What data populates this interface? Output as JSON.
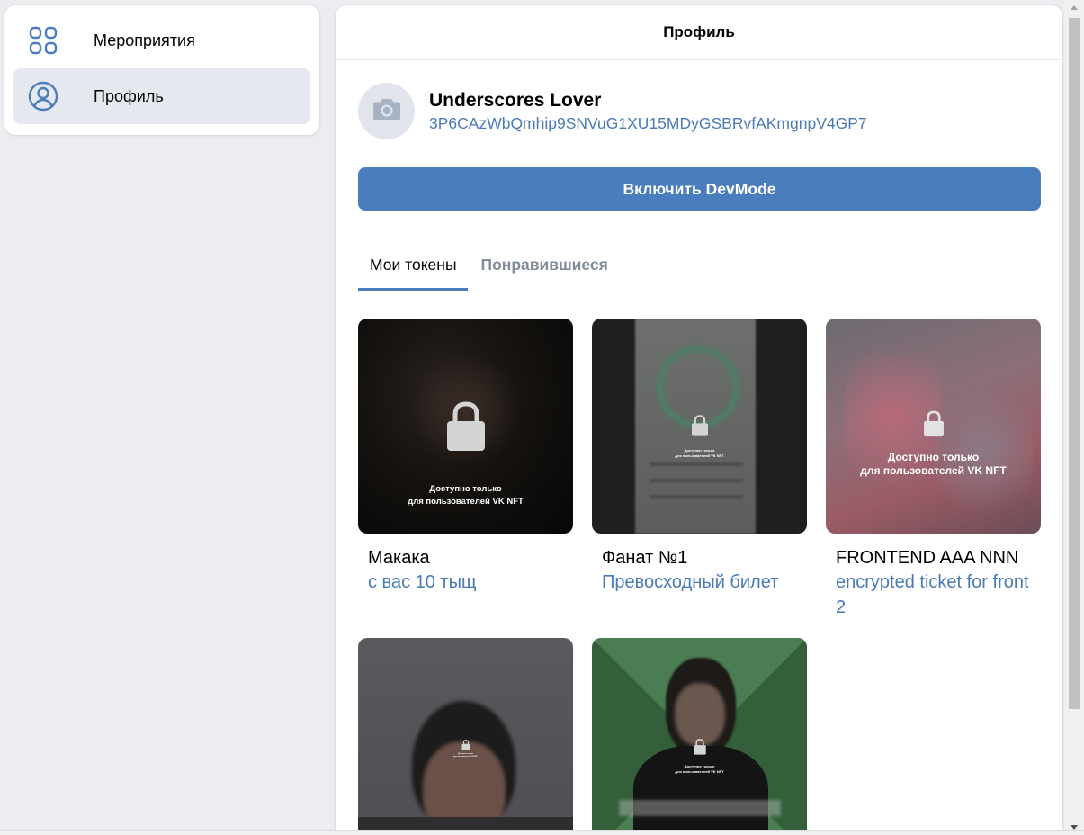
{
  "sidebar": {
    "items": [
      {
        "label": "Мероприятия",
        "icon": "grid-icon",
        "active": false
      },
      {
        "label": "Профиль",
        "icon": "user-circle-icon",
        "active": true
      }
    ]
  },
  "header": {
    "title": "Профиль"
  },
  "profile": {
    "name": "Underscores Lover",
    "address": "3P6CAzWbQmhip9SNVuG1XU15MDyGSBRvfAKmgnpV4GP7",
    "avatar_icon": "camera-icon"
  },
  "devmode_button": "Включить DevMode",
  "tabs": [
    {
      "label": "Мои токены",
      "active": true
    },
    {
      "label": "Понравившиеся",
      "active": false
    }
  ],
  "locked_text": [
    "Доступно только",
    "для пользователей VK NFT"
  ],
  "tokens": [
    {
      "title": "Макака",
      "subtitle": "с вас 10 тыщ"
    },
    {
      "title": "Фанат №1",
      "subtitle": "Превосходный билет"
    },
    {
      "title": "FRONTEND AAA NNN",
      "subtitle": "encrypted ticket for front 2"
    },
    {
      "title": "",
      "subtitle": ""
    },
    {
      "title": "",
      "subtitle": ""
    }
  ],
  "colors": {
    "accent": "#4a7dbd",
    "link": "#4a7ab5",
    "background": "#ebedf0"
  }
}
